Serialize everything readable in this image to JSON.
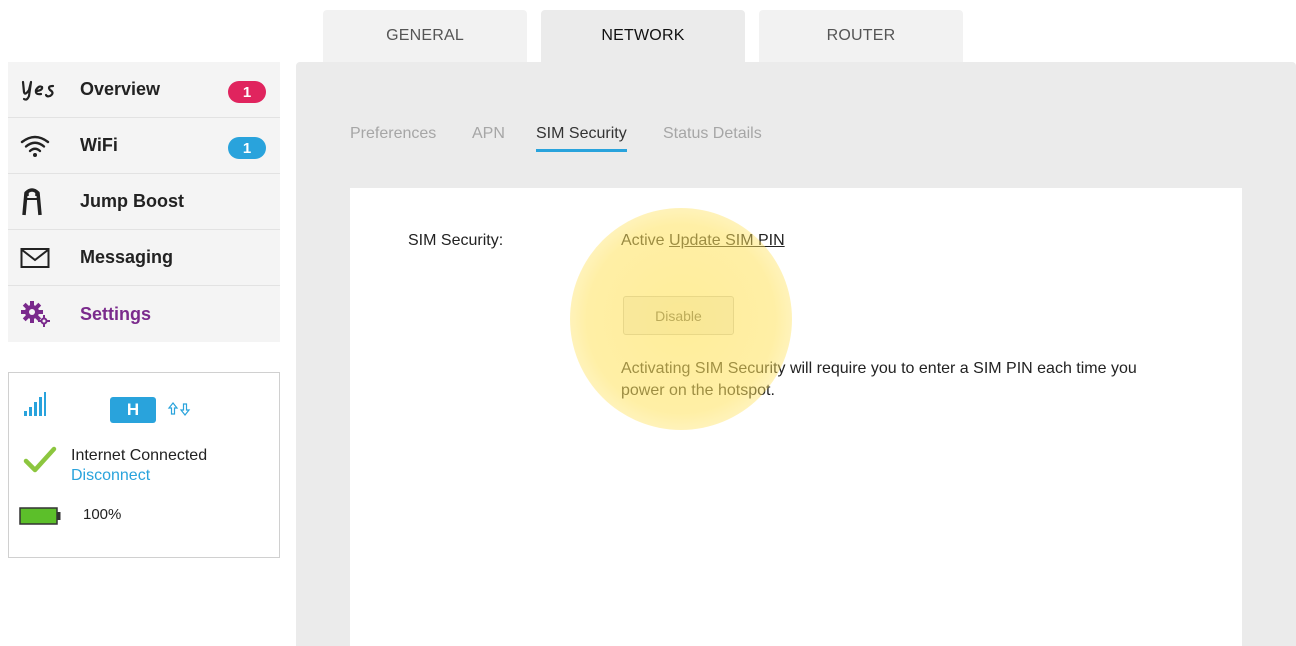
{
  "top_tabs": [
    {
      "label": "GENERAL",
      "active": false
    },
    {
      "label": "NETWORK",
      "active": true
    },
    {
      "label": "ROUTER",
      "active": false
    }
  ],
  "sidebar": {
    "items": [
      {
        "label": "Overview",
        "icon": "yes-logo-icon",
        "badge": "1",
        "badge_color": "#e0245e"
      },
      {
        "label": "WiFi",
        "icon": "wifi-icon",
        "badge": "1",
        "badge_color": "#29a3dc"
      },
      {
        "label": "Jump Boost",
        "icon": "jump-boost-icon"
      },
      {
        "label": "Messaging",
        "icon": "envelope-icon"
      },
      {
        "label": "Settings",
        "icon": "gears-icon",
        "active": true
      }
    ]
  },
  "status": {
    "network_type": "H",
    "connection": "Internet Connected",
    "disconnect": "Disconnect",
    "battery": "100%",
    "battery_level": 1.0
  },
  "sub_tabs": [
    {
      "label": "Preferences",
      "active": false
    },
    {
      "label": "APN",
      "active": false
    },
    {
      "label": "SIM Security",
      "active": true
    },
    {
      "label": "Status Details",
      "active": false
    }
  ],
  "sim_security": {
    "label": "SIM Security:",
    "status": "Active",
    "update_link": "Update SIM PIN",
    "disable_button": "Disable",
    "help_text": "Activating SIM Security will require you to enter a SIM PIN each time you power on the hotspot."
  },
  "colors": {
    "accent_blue": "#29a3dc",
    "settings_purple": "#7a2a8c",
    "battery_green": "#5cbf2a",
    "highlight": "#ffe25c"
  }
}
